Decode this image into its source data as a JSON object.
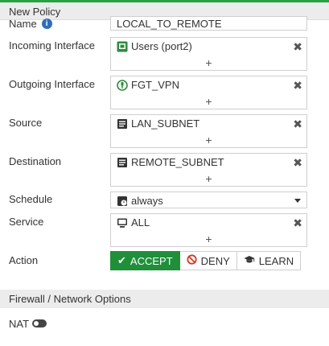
{
  "window": {
    "title": "New Policy"
  },
  "form": {
    "name": {
      "label": "Name",
      "value": "LOCAL_TO_REMOTE"
    },
    "incoming_interface": {
      "label": "Incoming Interface",
      "entry": "Users (port2)",
      "entry_icon": "ethernet-port-icon",
      "add": "+"
    },
    "outgoing_interface": {
      "label": "Outgoing Interface",
      "entry": "FGT_VPN",
      "entry_icon": "vpn-tunnel-icon",
      "add": "+"
    },
    "source": {
      "label": "Source",
      "entry": "LAN_SUBNET",
      "entry_icon": "address-object-icon",
      "add": "+"
    },
    "destination": {
      "label": "Destination",
      "entry": "REMOTE_SUBNET",
      "entry_icon": "address-object-icon",
      "add": "+"
    },
    "schedule": {
      "label": "Schedule",
      "value": "always",
      "entry_icon": "schedule-icon"
    },
    "service": {
      "label": "Service",
      "entry": "ALL",
      "entry_icon": "service-icon",
      "add": "+"
    },
    "action": {
      "label": "Action",
      "options": [
        "ACCEPT",
        "DENY",
        "LEARN"
      ],
      "selected": "ACCEPT"
    }
  },
  "firewall_section": {
    "title": "Firewall / Network Options",
    "nat": {
      "label": "NAT",
      "enabled": false
    }
  },
  "colors": {
    "accent": "#1f8f3a",
    "top_bar": "#27a243",
    "header_bg": "#ececec"
  }
}
